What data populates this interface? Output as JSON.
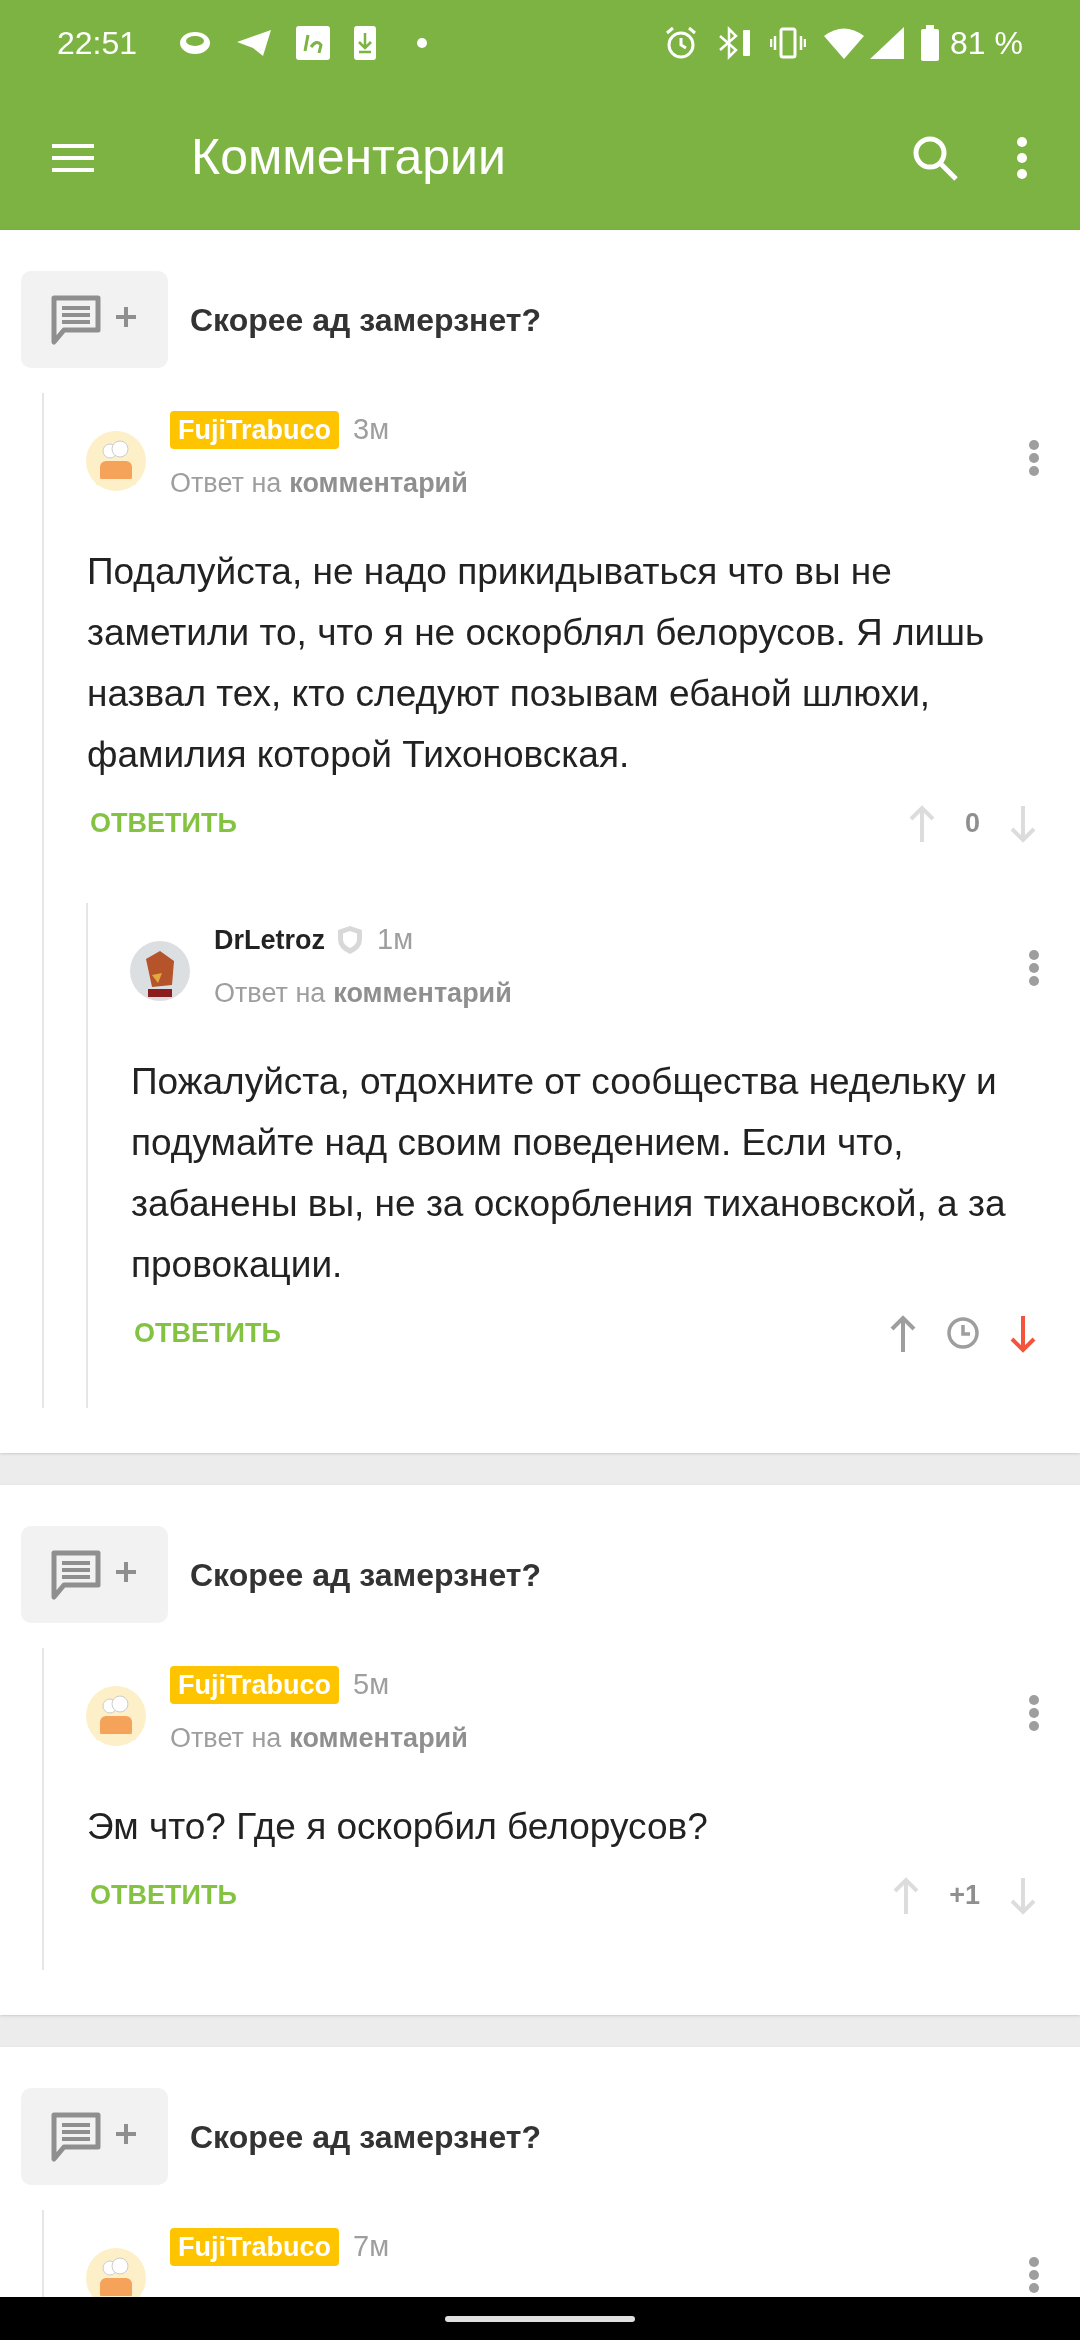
{
  "status_bar": {
    "time": "22:51",
    "battery": "81 %"
  },
  "app_bar": {
    "title": "Комментарии"
  },
  "sections": [
    {
      "post_title": "Скорее ад замерзнет?",
      "comments": [
        {
          "author": "FujiTrabuco",
          "author_badge": true,
          "moderator": false,
          "time": "3м",
          "reply_to": {
            "prefix": "Ответ на",
            "link": "комментарий"
          },
          "text": "Подалуйста, не надо прикидываться что вы не заметили то, что я не оскорблял белорусов. Я лишь назвал тех, кто следуют позывам ебаной шлюхи, фамилия которой Тихоновская.",
          "reply_label": "ОТВЕТИТЬ",
          "score": "0",
          "upvoted": false,
          "downvoted": false,
          "children": [
            {
              "author": "DrLetroz",
              "author_badge": false,
              "moderator": true,
              "time": "1м",
              "reply_to": {
                "prefix": "Ответ на",
                "link": "комментарий"
              },
              "text": "Пожалуйста, отдохните от сообщества недельку и подумайте над своим поведением. Если что, забанены вы, не за оскорбления тихановской, а за провокации.",
              "reply_label": "ОТВЕТИТЬ",
              "upvoted": false,
              "downvoted": true
            }
          ]
        }
      ]
    },
    {
      "post_title": "Скорее ад замерзнет?",
      "comments": [
        {
          "author": "FujiTrabuco",
          "author_badge": true,
          "moderator": false,
          "time": "5м",
          "reply_to": {
            "prefix": "Ответ на",
            "link": "комментарий"
          },
          "text": "Эм что? Где я оскорбил белорусов?",
          "reply_label": "ОТВЕТИТЬ",
          "score": "+1",
          "upvoted": false,
          "downvoted": false
        }
      ]
    },
    {
      "post_title": "Скорее ад замерзнет?",
      "comments": [
        {
          "author": "FujiTrabuco",
          "author_badge": true,
          "moderator": false,
          "time": "7м"
        }
      ]
    }
  ]
}
